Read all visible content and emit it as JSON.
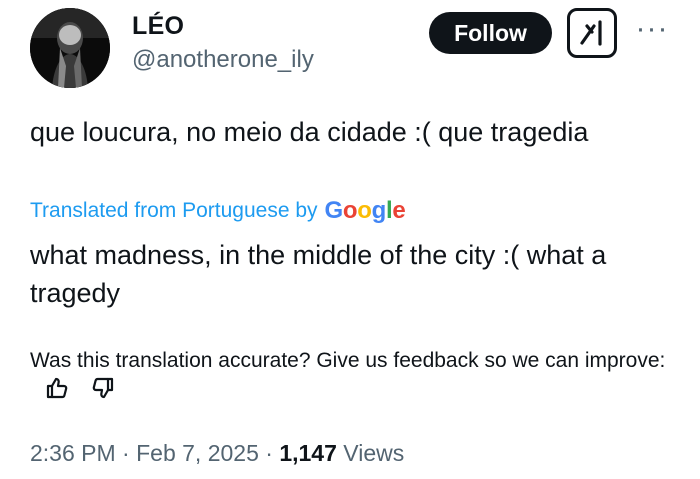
{
  "author": {
    "display_name": "LÉO",
    "handle": "@anotherone_ily"
  },
  "header": {
    "follow_label": "Follow",
    "more_label": "···"
  },
  "tweet": {
    "text": "que loucura, no meio da cidade :( que tragedia"
  },
  "translation": {
    "prefix": "Translated from Portuguese by",
    "provider_letters": [
      "G",
      "o",
      "o",
      "g",
      "l",
      "e"
    ],
    "provider_colors": [
      "#4285F4",
      "#EA4335",
      "#FBBC05",
      "#4285F4",
      "#34A853",
      "#EA4335"
    ],
    "text": "what madness, in the middle of the city :( what a tragedy"
  },
  "feedback": {
    "prompt": "Was this translation accurate? Give us feedback so we can improve:",
    "thumbs_up_icon": "thumbs-up-icon",
    "thumbs_down_icon": "thumbs-down-icon"
  },
  "meta": {
    "time": "2:36 PM",
    "separator": "·",
    "date": "Feb 7, 2025",
    "views_count": "1,147",
    "views_label": "Views"
  },
  "colors": {
    "text": "#0f1419",
    "secondary": "#536471",
    "link": "#1d9bf0",
    "button_bg": "#0f1419"
  }
}
